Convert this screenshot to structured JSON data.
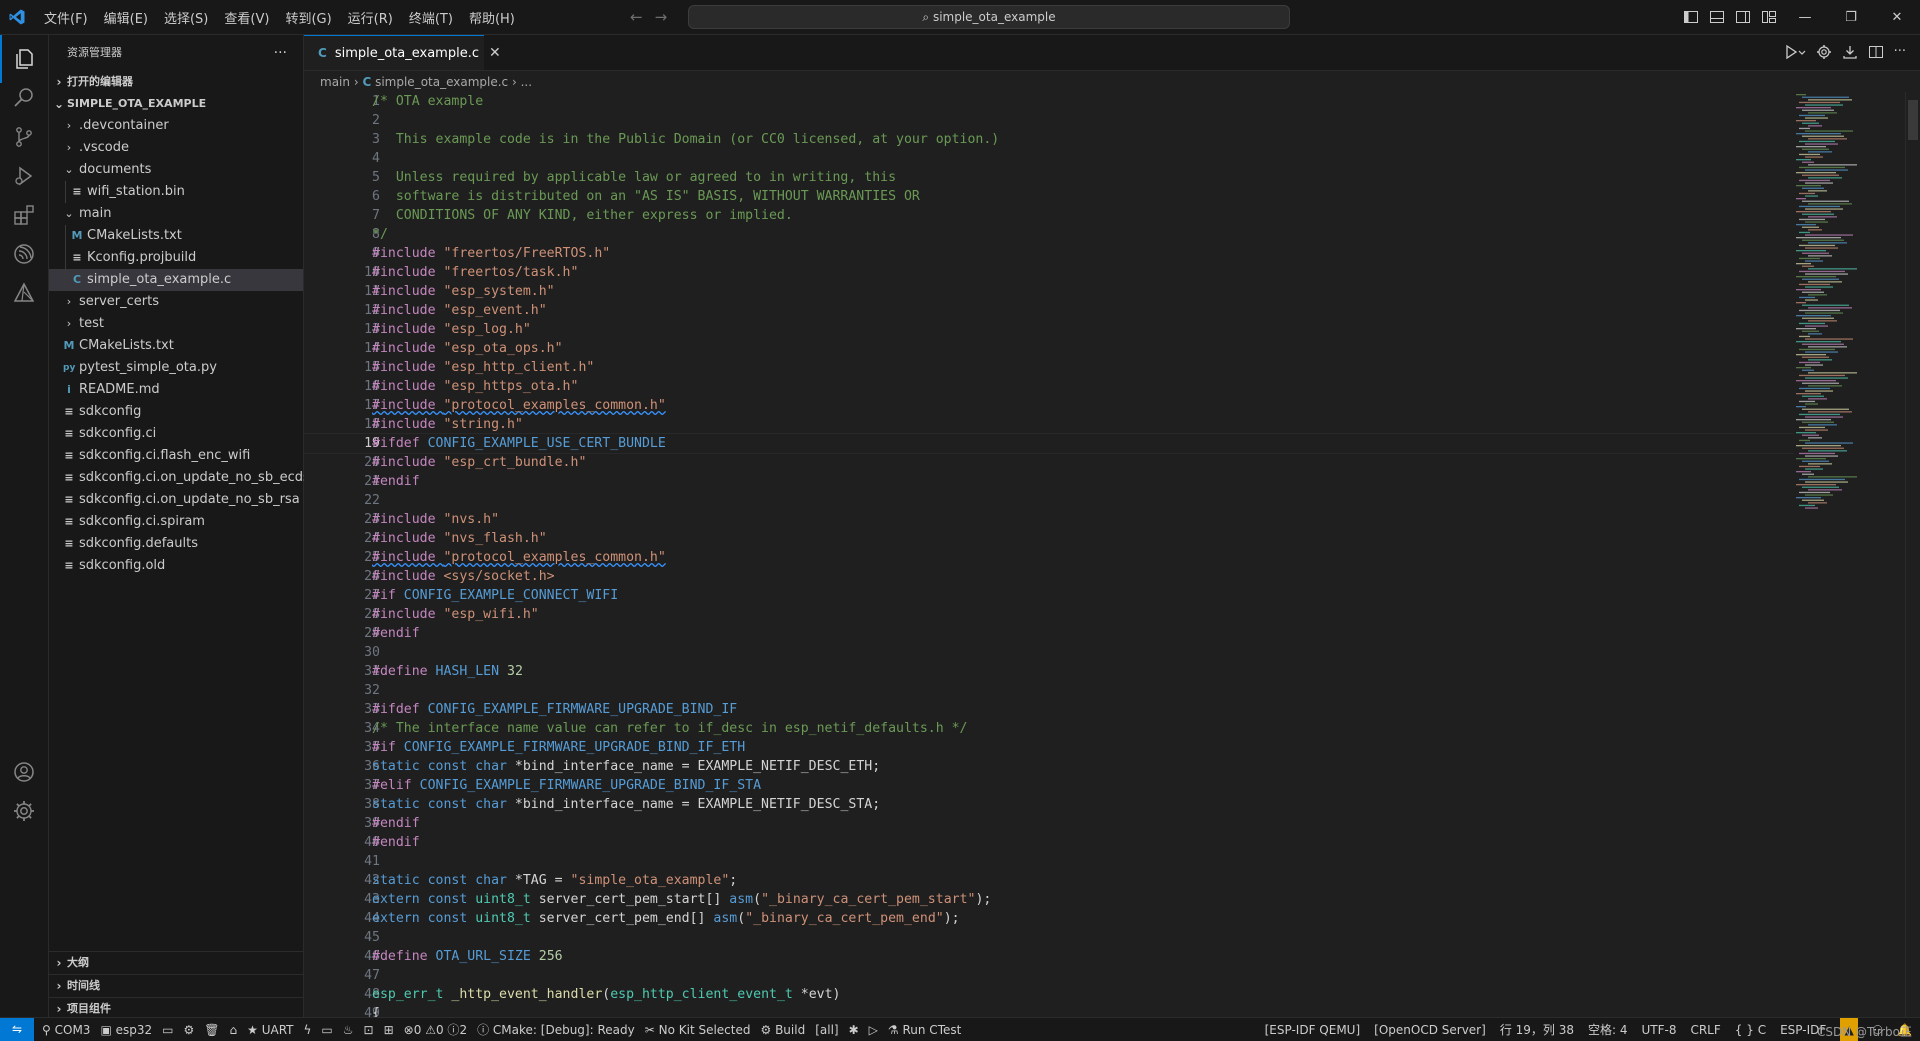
{
  "menu": [
    "文件(F)",
    "编辑(E)",
    "选择(S)",
    "查看(V)",
    "转到(G)",
    "运行(R)",
    "终端(T)",
    "帮助(H)"
  ],
  "command_center": "simple_ota_example",
  "explorer": {
    "title": "资源管理器",
    "open_editors": "打开的编辑器",
    "project": "SIMPLE_OTA_EXAMPLE",
    "tree": [
      {
        "label": ".devcontainer",
        "kind": "folder",
        "depth": 1,
        "open": false
      },
      {
        "label": ".vscode",
        "kind": "folder",
        "depth": 1,
        "open": false
      },
      {
        "label": "documents",
        "kind": "folder",
        "depth": 1,
        "open": true
      },
      {
        "label": "wifi_station.bin",
        "kind": "file",
        "depth": 2,
        "icon": "≡"
      },
      {
        "label": "main",
        "kind": "folder",
        "depth": 1,
        "open": true
      },
      {
        "label": "CMakeLists.txt",
        "kind": "file",
        "depth": 2,
        "icon": "M"
      },
      {
        "label": "Kconfig.projbuild",
        "kind": "file",
        "depth": 2,
        "icon": "≡"
      },
      {
        "label": "simple_ota_example.c",
        "kind": "file",
        "depth": 2,
        "icon": "C",
        "selected": true
      },
      {
        "label": "server_certs",
        "kind": "folder",
        "depth": 1,
        "open": false
      },
      {
        "label": "test",
        "kind": "folder",
        "depth": 1,
        "open": false
      },
      {
        "label": "CMakeLists.txt",
        "kind": "file",
        "depth": 1,
        "icon": "M"
      },
      {
        "label": "pytest_simple_ota.py",
        "kind": "file",
        "depth": 1,
        "icon": "py"
      },
      {
        "label": "README.md",
        "kind": "file",
        "depth": 1,
        "icon": "i"
      },
      {
        "label": "sdkconfig",
        "kind": "file",
        "depth": 1,
        "icon": "≡"
      },
      {
        "label": "sdkconfig.ci",
        "kind": "file",
        "depth": 1,
        "icon": "≡"
      },
      {
        "label": "sdkconfig.ci.flash_enc_wifi",
        "kind": "file",
        "depth": 1,
        "icon": "≡"
      },
      {
        "label": "sdkconfig.ci.on_update_no_sb_ecdsa",
        "kind": "file",
        "depth": 1,
        "icon": "≡"
      },
      {
        "label": "sdkconfig.ci.on_update_no_sb_rsa",
        "kind": "file",
        "depth": 1,
        "icon": "≡"
      },
      {
        "label": "sdkconfig.ci.spiram",
        "kind": "file",
        "depth": 1,
        "icon": "≡"
      },
      {
        "label": "sdkconfig.defaults",
        "kind": "file",
        "depth": 1,
        "icon": "≡"
      },
      {
        "label": "sdkconfig.old",
        "kind": "file",
        "depth": 1,
        "icon": "≡"
      }
    ],
    "bottom_sections": [
      "大纲",
      "时间线",
      "项目组件"
    ]
  },
  "tab": {
    "icon_letter": "C",
    "name": "simple_ota_example.c"
  },
  "breadcrumb": {
    "folder": "main",
    "file": "simple_ota_example.c",
    "tail": "..."
  },
  "active_line": 19,
  "code": [
    [
      [
        "c",
        "/* OTA example"
      ]
    ],
    [],
    [
      [
        "c",
        "   This example code is in the Public Domain (or CC0 licensed, at your option.)"
      ]
    ],
    [],
    [
      [
        "c",
        "   Unless required by applicable law or agreed to in writing, this"
      ]
    ],
    [
      [
        "c",
        "   software is distributed on an \"AS IS\" BASIS, WITHOUT WARRANTIES OR"
      ]
    ],
    [
      [
        "c",
        "   CONDITIONS OF ANY KIND, either express or implied."
      ]
    ],
    [
      [
        "c",
        "*/"
      ]
    ],
    [
      [
        "d",
        "#include "
      ],
      [
        "s",
        "\"freertos/FreeRTOS.h\""
      ]
    ],
    [
      [
        "d",
        "#include "
      ],
      [
        "s",
        "\"freertos/task.h\""
      ]
    ],
    [
      [
        "d",
        "#include "
      ],
      [
        "s",
        "\"esp_system.h\""
      ]
    ],
    [
      [
        "d",
        "#include "
      ],
      [
        "s",
        "\"esp_event.h\""
      ]
    ],
    [
      [
        "d",
        "#include "
      ],
      [
        "s",
        "\"esp_log.h\""
      ]
    ],
    [
      [
        "d",
        "#include "
      ],
      [
        "s",
        "\"esp_ota_ops.h\""
      ]
    ],
    [
      [
        "d",
        "#include "
      ],
      [
        "s",
        "\"esp_http_client.h\""
      ]
    ],
    [
      [
        "d",
        "#include "
      ],
      [
        "s",
        "\"esp_https_ota.h\""
      ]
    ],
    [
      [
        "dq",
        "#include "
      ],
      [
        "sq",
        "\"protocol_examples_common.h\""
      ]
    ],
    [
      [
        "d",
        "#include "
      ],
      [
        "s",
        "\"string.h\""
      ]
    ],
    [
      [
        "d",
        "#ifdef "
      ],
      [
        "m",
        "CONFIG_EXAMPLE_USE_CERT_BUNDLE"
      ]
    ],
    [
      [
        "d",
        "#include "
      ],
      [
        "s",
        "\"esp_crt_bundle.h\""
      ]
    ],
    [
      [
        "d",
        "#endif"
      ]
    ],
    [],
    [
      [
        "d",
        "#include "
      ],
      [
        "s",
        "\"nvs.h\""
      ]
    ],
    [
      [
        "d",
        "#include "
      ],
      [
        "s",
        "\"nvs_flash.h\""
      ]
    ],
    [
      [
        "dq",
        "#include "
      ],
      [
        "sq",
        "\"protocol_examples_common.h\""
      ]
    ],
    [
      [
        "d",
        "#include "
      ],
      [
        "s",
        "<sys/socket.h>"
      ]
    ],
    [
      [
        "d",
        "#if "
      ],
      [
        "m",
        "CONFIG_EXAMPLE_CONNECT_WIFI"
      ]
    ],
    [
      [
        "d",
        "#include "
      ],
      [
        "s",
        "\"esp_wifi.h\""
      ]
    ],
    [
      [
        "d",
        "#endif"
      ]
    ],
    [],
    [
      [
        "d",
        "#define "
      ],
      [
        "m",
        "HASH_LEN"
      ],
      [
        "n",
        " 32"
      ]
    ],
    [],
    [
      [
        "d",
        "#ifdef "
      ],
      [
        "m",
        "CONFIG_EXAMPLE_FIRMWARE_UPGRADE_BIND_IF"
      ]
    ],
    [
      [
        "c",
        "/* The interface name value can refer to if_desc in esp_netif_defaults.h */"
      ]
    ],
    [
      [
        "d",
        "#if "
      ],
      [
        "m",
        "CONFIG_EXAMPLE_FIRMWARE_UPGRADE_BIND_IF_ETH"
      ]
    ],
    [
      [
        "k",
        "static const char "
      ],
      [
        "i",
        "*bind_interface_name = EXAMPLE_NETIF_DESC_ETH;"
      ]
    ],
    [
      [
        "d",
        "#elif "
      ],
      [
        "m",
        "CONFIG_EXAMPLE_FIRMWARE_UPGRADE_BIND_IF_STA"
      ]
    ],
    [
      [
        "k",
        "static const char "
      ],
      [
        "i",
        "*bind_interface_name = EXAMPLE_NETIF_DESC_STA;"
      ]
    ],
    [
      [
        "d",
        "#endif"
      ]
    ],
    [
      [
        "d",
        "#endif"
      ]
    ],
    [],
    [
      [
        "k",
        "static const char "
      ],
      [
        "i",
        "*TAG = "
      ],
      [
        "s",
        "\"simple_ota_example\""
      ],
      [
        "i",
        ";"
      ]
    ],
    [
      [
        "k",
        "extern const "
      ],
      [
        "t",
        "uint8_t"
      ],
      [
        "i",
        " server_cert_pem_start[] "
      ],
      [
        "k",
        "asm"
      ],
      [
        "i",
        "("
      ],
      [
        "s",
        "\"_binary_ca_cert_pem_start\""
      ],
      [
        "i",
        ");"
      ]
    ],
    [
      [
        "k",
        "extern const "
      ],
      [
        "t",
        "uint8_t"
      ],
      [
        "i",
        " server_cert_pem_end[] "
      ],
      [
        "k",
        "asm"
      ],
      [
        "i",
        "("
      ],
      [
        "s",
        "\"_binary_ca_cert_pem_end\""
      ],
      [
        "i",
        ");"
      ]
    ],
    [],
    [
      [
        "d",
        "#define "
      ],
      [
        "m",
        "OTA_URL_SIZE"
      ],
      [
        "n",
        " 256"
      ]
    ],
    [],
    [
      [
        "t",
        "esp_err_t"
      ],
      [
        "f",
        " _http_event_handler"
      ],
      [
        "i",
        "("
      ],
      [
        "t",
        "esp_http_client_event_t"
      ],
      [
        "i",
        " *evt)"
      ]
    ],
    [
      [
        "i",
        "{"
      ]
    ]
  ],
  "status": {
    "port": "COM3",
    "target": "esp32",
    "flash_method": "UART",
    "problems_errors": "0",
    "problems_warnings": "0",
    "notifications": "2",
    "cmake": "CMake: [Debug]: Ready",
    "kit": "No Kit Selected",
    "build": "Build",
    "build_target": "[all]",
    "run_ctest": "Run CTest",
    "qemu": "[ESP-IDF QEMU]",
    "openocd": "[OpenOCD Server]",
    "cursor": "行 19，列 38",
    "indent": "空格: 4",
    "encoding": "UTF-8",
    "eol": "CRLF",
    "language": "C",
    "idf": "ESP-IDF"
  },
  "watermark": "CSDN @Turbo正",
  "colors": {
    "accent": "#0078d4",
    "comment": "#6a9955",
    "preprocessor": "#c586c0",
    "string": "#ce9178",
    "keyword": "#569cd6",
    "type": "#4ec9b0",
    "function": "#dcdcaa"
  }
}
